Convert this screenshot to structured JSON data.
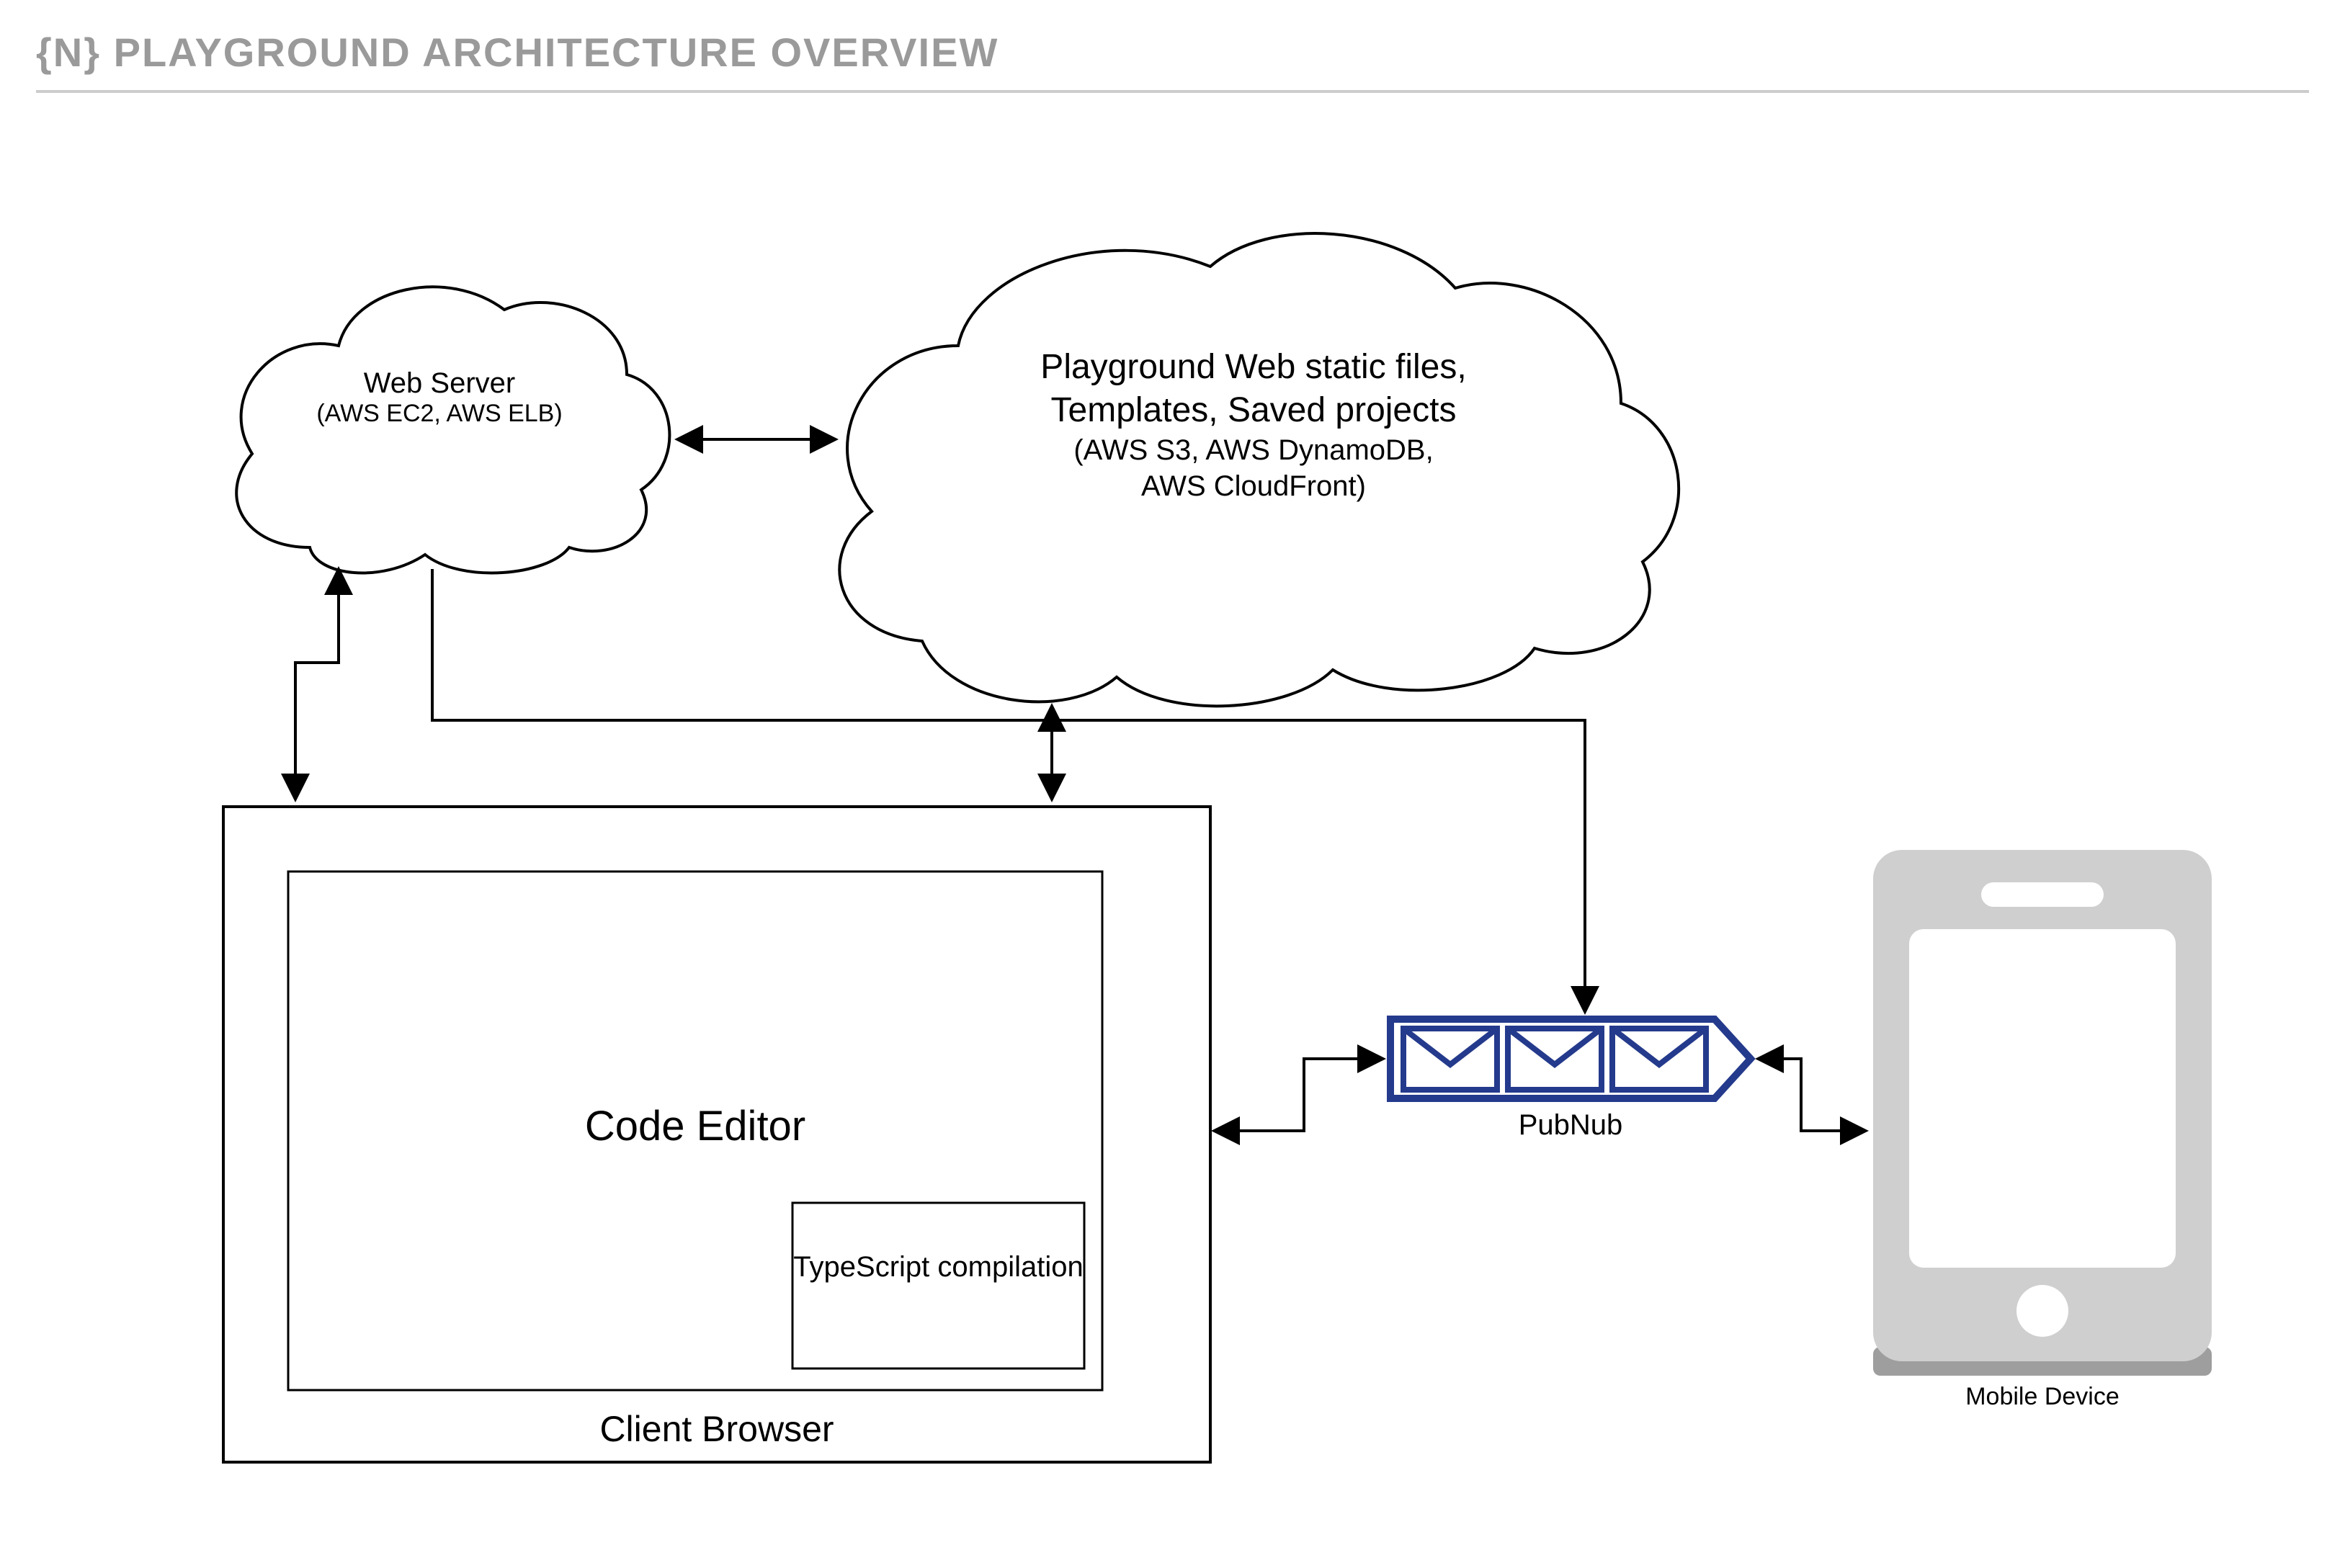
{
  "title": "{N} PLAYGROUND ARCHITECTURE OVERVIEW",
  "webserver": {
    "line1": "Web Server",
    "line2": "(AWS EC2, AWS ELB)"
  },
  "storage": {
    "line1": "Playground Web static files,",
    "line2": "Templates, Saved projects",
    "line3": "(AWS S3, AWS DynamoDB,",
    "line4": "AWS CloudFront)"
  },
  "browser": {
    "label": "Client Browser",
    "editor": "Code Editor",
    "ts": "TypeScript compilation"
  },
  "pubnub": {
    "label": "PubNub"
  },
  "mobile": {
    "label": "Mobile Device"
  }
}
